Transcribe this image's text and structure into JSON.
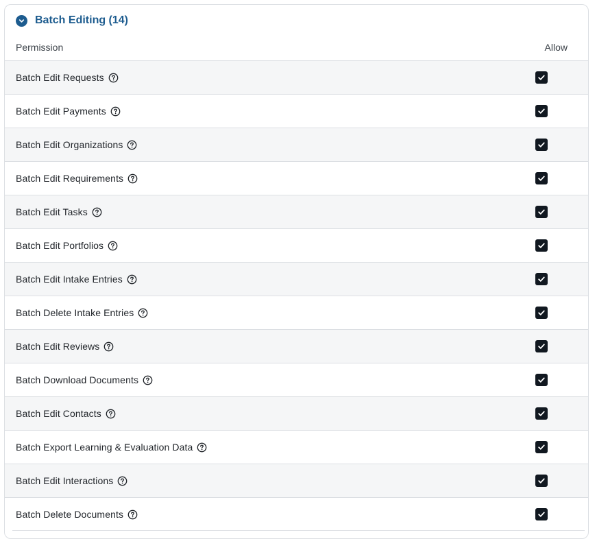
{
  "section": {
    "title": "Batch Editing (14)",
    "icon": "chevron-down-icon",
    "accent_color": "#1d5c8f"
  },
  "columns": {
    "permission": "Permission",
    "allow": "Allow"
  },
  "rows": [
    {
      "label": "Batch Edit Requests",
      "allowed": true
    },
    {
      "label": "Batch Edit Payments",
      "allowed": true
    },
    {
      "label": "Batch Edit Organizations",
      "allowed": true
    },
    {
      "label": "Batch Edit Requirements",
      "allowed": true
    },
    {
      "label": "Batch Edit Tasks",
      "allowed": true
    },
    {
      "label": "Batch Edit Portfolios",
      "allowed": true
    },
    {
      "label": "Batch Edit Intake Entries",
      "allowed": true
    },
    {
      "label": "Batch Delete Intake Entries",
      "allowed": true
    },
    {
      "label": "Batch Edit Reviews",
      "allowed": true
    },
    {
      "label": "Batch Download Documents",
      "allowed": true
    },
    {
      "label": "Batch Edit Contacts",
      "allowed": true
    },
    {
      "label": "Batch Export Learning & Evaluation Data",
      "allowed": true
    },
    {
      "label": "Batch Edit Interactions",
      "allowed": true
    },
    {
      "label": "Batch Delete Documents",
      "allowed": true
    }
  ]
}
